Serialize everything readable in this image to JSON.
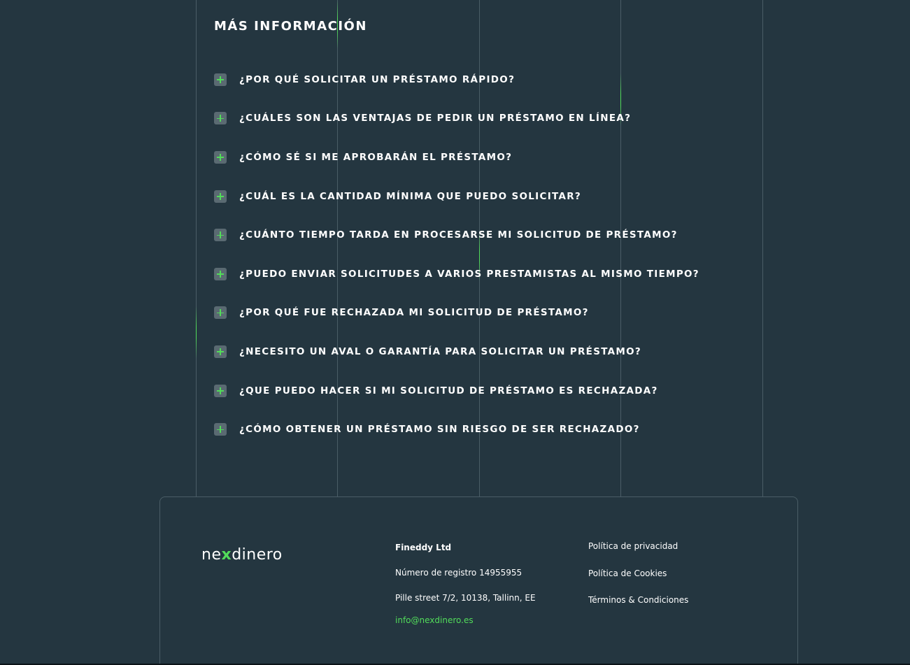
{
  "faq": {
    "title": "Más información",
    "questions": [
      "¿Por qué solicitar un préstamo rápido?",
      "¿Cuáles son las ventajas de pedir un préstamo en línea?",
      "¿Cómo sé si me aprobarán el préstamo?",
      "¿Cuál es la cantidad mínima que puedo solicitar?",
      "¿Cuánto tiempo tarda en procesarse mi solicitud de préstamo?",
      "¿Puedo enviar solicitudes a varios prestamistas al mismo tiempo?",
      "¿Por qué fue rechazada mi solicitud de préstamo?",
      "¿Necesito un aval o garantía para solicitar un préstamo?",
      "¿Que puedo hacer si mi solicitud de préstamo es rechazada?",
      "¿Cómo obtener un préstamo sin riesgo de ser rechazado?"
    ]
  },
  "footer": {
    "logo": {
      "part1": "ne",
      "part2": "x",
      "part3": "dinero"
    },
    "company": {
      "name": "Fineddy Ltd",
      "registration": "Número de registro 14955955",
      "address": "Pille street 7/2, 10138, Tallinn, EE",
      "email": "info@nexdinero.es"
    },
    "links": [
      "Política de privacidad",
      "Política de Cookies",
      "Términos & Condiciones"
    ]
  },
  "colors": {
    "background": "#243640",
    "accent": "#52dc5a",
    "text": "#ffffff",
    "plus_box": "#5a6a72"
  }
}
